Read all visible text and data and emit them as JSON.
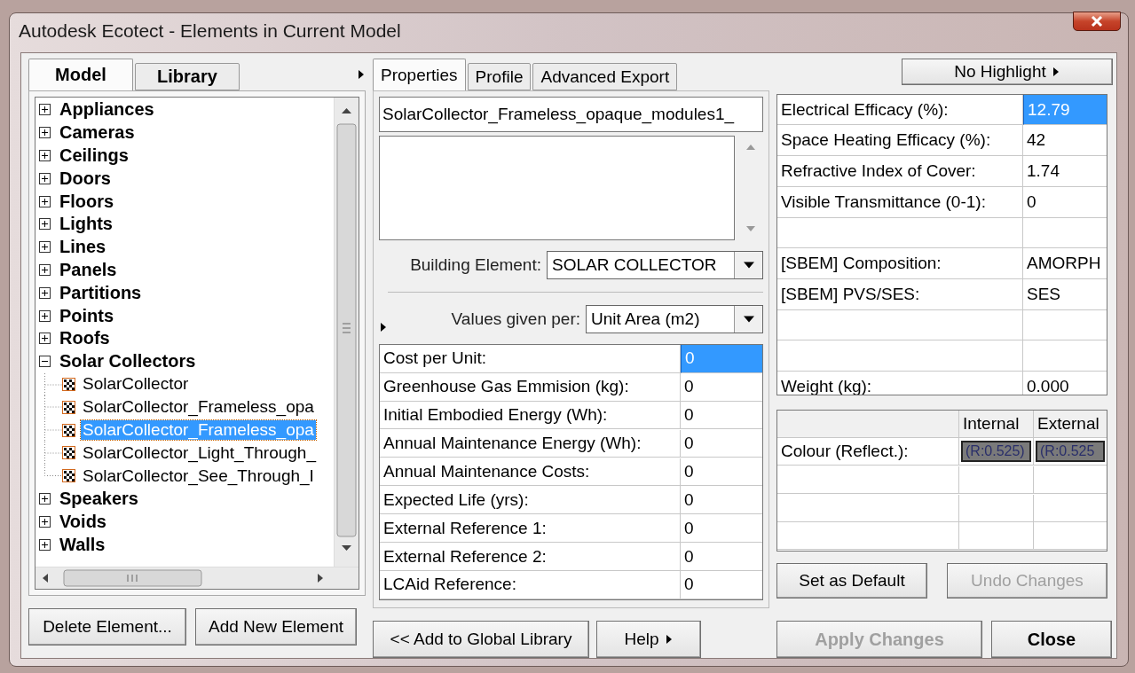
{
  "window": {
    "title": "Autodesk Ecotect - Elements in Current Model"
  },
  "left_tabs": [
    {
      "label": "Model",
      "selected": true
    },
    {
      "label": "Library",
      "selected": false
    }
  ],
  "tree": [
    {
      "label": "Appliances",
      "expanded": false
    },
    {
      "label": "Cameras",
      "expanded": false
    },
    {
      "label": "Ceilings",
      "expanded": false
    },
    {
      "label": "Doors",
      "expanded": false
    },
    {
      "label": "Floors",
      "expanded": false
    },
    {
      "label": "Lights",
      "expanded": false
    },
    {
      "label": "Lines",
      "expanded": false
    },
    {
      "label": "Panels",
      "expanded": false
    },
    {
      "label": "Partitions",
      "expanded": false
    },
    {
      "label": "Points",
      "expanded": false
    },
    {
      "label": "Roofs",
      "expanded": false
    },
    {
      "label": "Solar Collectors",
      "expanded": true,
      "children": [
        {
          "label": "SolarCollector",
          "selected": false
        },
        {
          "label": "SolarCollector_Frameless_opa",
          "selected": false
        },
        {
          "label": "SolarCollector_Frameless_opa",
          "selected": true
        },
        {
          "label": "SolarCollector_Light_Through_",
          "selected": false
        },
        {
          "label": "SolarCollector_See_Through_I",
          "selected": false
        }
      ]
    },
    {
      "label": "Speakers",
      "expanded": false
    },
    {
      "label": "Voids",
      "expanded": false
    },
    {
      "label": "Walls",
      "expanded": false
    }
  ],
  "left_buttons": [
    "Delete Element...",
    "Add New Element"
  ],
  "middle_tabs": [
    {
      "label": "Properties",
      "selected": true
    },
    {
      "label": "Profile",
      "selected": false
    },
    {
      "label": "Advanced Export",
      "selected": false
    }
  ],
  "element_name": "SolarCollector_Frameless_opaque_modules1_",
  "building_element": {
    "label": "Building Element:",
    "value": "SOLAR COLLECTOR"
  },
  "values_given_per": {
    "label": "Values given per:",
    "value": "Unit Area (m2)"
  },
  "cost_rows": [
    {
      "label": "Cost per Unit:",
      "value": "0",
      "selected": true
    },
    {
      "label": "Greenhouse Gas Emmision (kg):",
      "value": "0",
      "selected": false
    },
    {
      "label": "Initial Embodied Energy (Wh):",
      "value": "0",
      "selected": false
    },
    {
      "label": "Annual Maintenance Energy (Wh):",
      "value": "0",
      "selected": false
    },
    {
      "label": "Annual Maintenance Costs:",
      "value": "0",
      "selected": false
    },
    {
      "label": "Expected Life (yrs):",
      "value": "0",
      "selected": false
    },
    {
      "label": "External Reference 1:",
      "value": "0",
      "selected": false
    },
    {
      "label": "External Reference 2:",
      "value": "0",
      "selected": false
    },
    {
      "label": "LCAid Reference:",
      "value": "0",
      "selected": false
    }
  ],
  "middle_buttons": [
    "<< Add to Global Library",
    "Help"
  ],
  "highlight_button": "No Highlight",
  "property_rows": [
    {
      "kind": "field",
      "label": "Electrical Efficacy (%):",
      "value": "12.79",
      "selected": true
    },
    {
      "kind": "field",
      "label": "Space Heating Efficacy (%):",
      "value": "42",
      "selected": false
    },
    {
      "kind": "field",
      "label": "Refractive Index of Cover:",
      "value": "1.74",
      "selected": false
    },
    {
      "kind": "field",
      "label": "Visible Transmittance (0-1):",
      "value": "0",
      "selected": false
    },
    {
      "kind": "blank"
    },
    {
      "kind": "field",
      "label": "[SBEM] Composition:",
      "value": "AMORPH",
      "selected": false
    },
    {
      "kind": "field",
      "label": "[SBEM] PVS/SES:",
      "value": "SES",
      "selected": false
    },
    {
      "kind": "blank"
    },
    {
      "kind": "blank"
    },
    {
      "kind": "field",
      "label": "Weight (kg):",
      "value": "0.000",
      "selected": false
    }
  ],
  "colour_table": {
    "columns": [
      "Internal",
      "External"
    ],
    "rows": [
      {
        "kind": "field",
        "label": "Colour (Reflect.):",
        "internal": "(R:0.525)",
        "external": "(R:0.525"
      },
      {
        "kind": "blank"
      },
      {
        "kind": "blank"
      },
      {
        "kind": "blank"
      }
    ]
  },
  "right_buttons": [
    {
      "label": "Set as Default",
      "disabled": false
    },
    {
      "label": "Undo Changes",
      "disabled": true
    }
  ],
  "dialog_buttons": [
    {
      "label": "Apply Changes",
      "disabled": true
    },
    {
      "label": "Close",
      "disabled": false
    }
  ]
}
